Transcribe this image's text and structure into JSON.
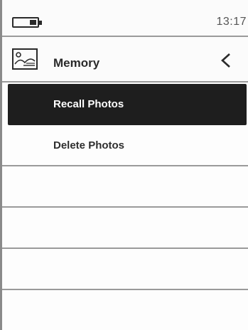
{
  "status": {
    "battery_icon": "battery-icon",
    "time": "13:17"
  },
  "header": {
    "icon": "image-icon",
    "title": "Memory",
    "back_icon": "chevron-left-icon"
  },
  "menu": {
    "items": [
      {
        "label": "Recall Photos",
        "selected": true
      },
      {
        "label": "Delete Photos",
        "selected": false
      },
      {
        "label": "",
        "selected": false
      },
      {
        "label": "",
        "selected": false
      },
      {
        "label": "",
        "selected": false
      },
      {
        "label": "",
        "selected": false
      }
    ]
  },
  "colors": {
    "selected_bg": "#1e1e1e",
    "divider": "#9a9a9a",
    "text": "#2a2a2a"
  }
}
